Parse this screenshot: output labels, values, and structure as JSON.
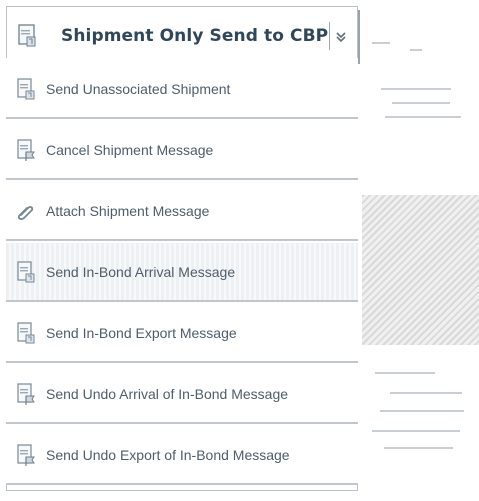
{
  "colors": {
    "header_text": "#30475a",
    "item_text": "#4e5d6b",
    "divider": "#c0c6cc",
    "accent": "#6ad0c8"
  },
  "header": {
    "icon": "document-icon",
    "title": "Shipment Only Send to CBP",
    "toggle_icon": "chevron-down-icon"
  },
  "menu": {
    "items": [
      {
        "icon": "document-icon",
        "label": "Send Unassociated Shipment"
      },
      {
        "icon": "document-flag-icon",
        "label": "Cancel Shipment Message"
      },
      {
        "icon": "paperclip-icon",
        "label": "Attach Shipment Message"
      },
      {
        "icon": "document-icon",
        "label": "Send In-Bond Arrival Message"
      },
      {
        "icon": "document-icon",
        "label": "Send In-Bond Export Message"
      },
      {
        "icon": "document-flag-icon",
        "label": "Send Undo Arrival of In-Bond Message"
      },
      {
        "icon": "document-flag-icon",
        "label": "Send Undo Export of In-Bond Message"
      }
    ]
  }
}
